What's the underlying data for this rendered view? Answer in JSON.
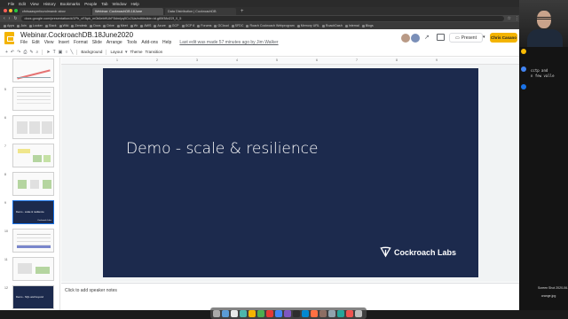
{
  "menubar": {
    "app": "Chrome",
    "items": [
      "File",
      "Edit",
      "View",
      "History",
      "Bookmarks",
      "People",
      "Tab",
      "Window",
      "Help"
    ]
  },
  "browser": {
    "tabs": [
      {
        "label": "cfntsaasymfoundmandr abov",
        "active": false
      },
      {
        "label": "Webinar: CockroachDB.18June",
        "active": true
      },
      {
        "label": "Data Distribution | CockroachDB",
        "active": false
      }
    ],
    "url": "docs.google.com/presentation/d/1Ph_nFApk_m0k6ebHUhF8dmlyq9Cc2Ua/edit#slide=id.g85f38d22f_0_5",
    "bookmarks": [
      "Apps",
      "Join",
      "Looker",
      "Slack",
      "Wiki",
      "Zendesk",
      "Docs",
      "Drive",
      "Meet",
      "Wr",
      "AWS",
      "Azure",
      "GCP",
      "GCP 8",
      "Forums",
      "GCloud",
      "SFDC",
      "Roach Cockroach Webprogram",
      "Memory URL",
      "RoachDash",
      "Internal",
      "Blogs"
    ]
  },
  "doc": {
    "title": "Webinar.CockroachDB.18June2020",
    "star": "☆",
    "menus": [
      "File",
      "Edit",
      "View",
      "Insert",
      "Format",
      "Slide",
      "Arrange",
      "Tools",
      "Add-ons",
      "Help"
    ],
    "last_edit": "Last edit was made 57 minutes ago by Jim Walker",
    "present_label": "Present",
    "share_label": "Chris Casano"
  },
  "toolbar": {
    "background": "Background",
    "layout": "Layout",
    "theme": "Theme",
    "transition": "Transition"
  },
  "ruler_ticks": [
    "1",
    "2",
    "3",
    "4",
    "5",
    "6",
    "7",
    "8",
    "9"
  ],
  "filmstrip": [
    {
      "num": "",
      "kind": "chart",
      "text": "",
      "logo": ""
    },
    {
      "num": "5",
      "kind": "text",
      "text": "",
      "logo": ""
    },
    {
      "num": "6",
      "kind": "table",
      "text": "",
      "logo": ""
    },
    {
      "num": "7",
      "kind": "diagram",
      "text": "",
      "logo": ""
    },
    {
      "num": "8",
      "kind": "diagram",
      "text": "",
      "logo": ""
    },
    {
      "num": "9",
      "kind": "dark",
      "text": "Demo - scale & resilience",
      "logo": "Cockroach Labs"
    },
    {
      "num": "10",
      "kind": "text",
      "text": "",
      "logo": ""
    },
    {
      "num": "11",
      "kind": "diagram",
      "text": "",
      "logo": ""
    },
    {
      "num": "12",
      "kind": "dark",
      "text": "Demo - SQL and beyond",
      "logo": ""
    }
  ],
  "slide": {
    "title": "Demo - scale & resilience",
    "logo_text": "Cockroach Labs"
  },
  "notes": {
    "placeholder": "Click to add speaker notes"
  },
  "terminal": {
    "lines": [
      "cctp and",
      "n few valle",
      "",
      "",
      ""
    ]
  },
  "desktop_files": [
    {
      "label": "Screen Shot 2020-06..."
    },
    {
      "label": "orange.jpg"
    }
  ],
  "colors": {
    "slide_bg": "#1c2a4d",
    "accent": "#f4b400",
    "selection": "#1a73e8"
  }
}
